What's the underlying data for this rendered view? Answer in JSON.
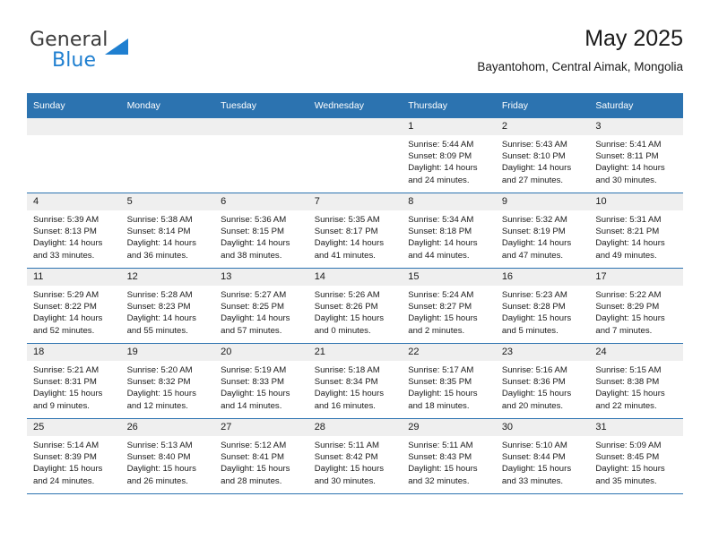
{
  "logo": {
    "text_top": "General",
    "text_bottom": "Blue",
    "triangle_icon": "triangle-icon",
    "color_blue": "#1f7fd0",
    "color_dark": "#3b3b3b"
  },
  "header": {
    "title": "May 2025",
    "subtitle": "Bayantohom, Central Aimak, Mongolia"
  },
  "theme": {
    "header_blue": "#2c73b0",
    "daynum_gray": "#efefef"
  },
  "calendar": {
    "weekday_headers": [
      "Sunday",
      "Monday",
      "Tuesday",
      "Wednesday",
      "Thursday",
      "Friday",
      "Saturday"
    ],
    "weeks": [
      [
        {
          "day": "",
          "empty": true
        },
        {
          "day": "",
          "empty": true
        },
        {
          "day": "",
          "empty": true
        },
        {
          "day": "",
          "empty": true
        },
        {
          "day": "1",
          "sunrise": "Sunrise: 5:44 AM",
          "sunset": "Sunset: 8:09 PM",
          "daylight1": "Daylight: 14 hours",
          "daylight2": "and 24 minutes."
        },
        {
          "day": "2",
          "sunrise": "Sunrise: 5:43 AM",
          "sunset": "Sunset: 8:10 PM",
          "daylight1": "Daylight: 14 hours",
          "daylight2": "and 27 minutes."
        },
        {
          "day": "3",
          "sunrise": "Sunrise: 5:41 AM",
          "sunset": "Sunset: 8:11 PM",
          "daylight1": "Daylight: 14 hours",
          "daylight2": "and 30 minutes."
        }
      ],
      [
        {
          "day": "4",
          "sunrise": "Sunrise: 5:39 AM",
          "sunset": "Sunset: 8:13 PM",
          "daylight1": "Daylight: 14 hours",
          "daylight2": "and 33 minutes."
        },
        {
          "day": "5",
          "sunrise": "Sunrise: 5:38 AM",
          "sunset": "Sunset: 8:14 PM",
          "daylight1": "Daylight: 14 hours",
          "daylight2": "and 36 minutes."
        },
        {
          "day": "6",
          "sunrise": "Sunrise: 5:36 AM",
          "sunset": "Sunset: 8:15 PM",
          "daylight1": "Daylight: 14 hours",
          "daylight2": "and 38 minutes."
        },
        {
          "day": "7",
          "sunrise": "Sunrise: 5:35 AM",
          "sunset": "Sunset: 8:17 PM",
          "daylight1": "Daylight: 14 hours",
          "daylight2": "and 41 minutes."
        },
        {
          "day": "8",
          "sunrise": "Sunrise: 5:34 AM",
          "sunset": "Sunset: 8:18 PM",
          "daylight1": "Daylight: 14 hours",
          "daylight2": "and 44 minutes."
        },
        {
          "day": "9",
          "sunrise": "Sunrise: 5:32 AM",
          "sunset": "Sunset: 8:19 PM",
          "daylight1": "Daylight: 14 hours",
          "daylight2": "and 47 minutes."
        },
        {
          "day": "10",
          "sunrise": "Sunrise: 5:31 AM",
          "sunset": "Sunset: 8:21 PM",
          "daylight1": "Daylight: 14 hours",
          "daylight2": "and 49 minutes."
        }
      ],
      [
        {
          "day": "11",
          "sunrise": "Sunrise: 5:29 AM",
          "sunset": "Sunset: 8:22 PM",
          "daylight1": "Daylight: 14 hours",
          "daylight2": "and 52 minutes."
        },
        {
          "day": "12",
          "sunrise": "Sunrise: 5:28 AM",
          "sunset": "Sunset: 8:23 PM",
          "daylight1": "Daylight: 14 hours",
          "daylight2": "and 55 minutes."
        },
        {
          "day": "13",
          "sunrise": "Sunrise: 5:27 AM",
          "sunset": "Sunset: 8:25 PM",
          "daylight1": "Daylight: 14 hours",
          "daylight2": "and 57 minutes."
        },
        {
          "day": "14",
          "sunrise": "Sunrise: 5:26 AM",
          "sunset": "Sunset: 8:26 PM",
          "daylight1": "Daylight: 15 hours",
          "daylight2": "and 0 minutes."
        },
        {
          "day": "15",
          "sunrise": "Sunrise: 5:24 AM",
          "sunset": "Sunset: 8:27 PM",
          "daylight1": "Daylight: 15 hours",
          "daylight2": "and 2 minutes."
        },
        {
          "day": "16",
          "sunrise": "Sunrise: 5:23 AM",
          "sunset": "Sunset: 8:28 PM",
          "daylight1": "Daylight: 15 hours",
          "daylight2": "and 5 minutes."
        },
        {
          "day": "17",
          "sunrise": "Sunrise: 5:22 AM",
          "sunset": "Sunset: 8:29 PM",
          "daylight1": "Daylight: 15 hours",
          "daylight2": "and 7 minutes."
        }
      ],
      [
        {
          "day": "18",
          "sunrise": "Sunrise: 5:21 AM",
          "sunset": "Sunset: 8:31 PM",
          "daylight1": "Daylight: 15 hours",
          "daylight2": "and 9 minutes."
        },
        {
          "day": "19",
          "sunrise": "Sunrise: 5:20 AM",
          "sunset": "Sunset: 8:32 PM",
          "daylight1": "Daylight: 15 hours",
          "daylight2": "and 12 minutes."
        },
        {
          "day": "20",
          "sunrise": "Sunrise: 5:19 AM",
          "sunset": "Sunset: 8:33 PM",
          "daylight1": "Daylight: 15 hours",
          "daylight2": "and 14 minutes."
        },
        {
          "day": "21",
          "sunrise": "Sunrise: 5:18 AM",
          "sunset": "Sunset: 8:34 PM",
          "daylight1": "Daylight: 15 hours",
          "daylight2": "and 16 minutes."
        },
        {
          "day": "22",
          "sunrise": "Sunrise: 5:17 AM",
          "sunset": "Sunset: 8:35 PM",
          "daylight1": "Daylight: 15 hours",
          "daylight2": "and 18 minutes."
        },
        {
          "day": "23",
          "sunrise": "Sunrise: 5:16 AM",
          "sunset": "Sunset: 8:36 PM",
          "daylight1": "Daylight: 15 hours",
          "daylight2": "and 20 minutes."
        },
        {
          "day": "24",
          "sunrise": "Sunrise: 5:15 AM",
          "sunset": "Sunset: 8:38 PM",
          "daylight1": "Daylight: 15 hours",
          "daylight2": "and 22 minutes."
        }
      ],
      [
        {
          "day": "25",
          "sunrise": "Sunrise: 5:14 AM",
          "sunset": "Sunset: 8:39 PM",
          "daylight1": "Daylight: 15 hours",
          "daylight2": "and 24 minutes."
        },
        {
          "day": "26",
          "sunrise": "Sunrise: 5:13 AM",
          "sunset": "Sunset: 8:40 PM",
          "daylight1": "Daylight: 15 hours",
          "daylight2": "and 26 minutes."
        },
        {
          "day": "27",
          "sunrise": "Sunrise: 5:12 AM",
          "sunset": "Sunset: 8:41 PM",
          "daylight1": "Daylight: 15 hours",
          "daylight2": "and 28 minutes."
        },
        {
          "day": "28",
          "sunrise": "Sunrise: 5:11 AM",
          "sunset": "Sunset: 8:42 PM",
          "daylight1": "Daylight: 15 hours",
          "daylight2": "and 30 minutes."
        },
        {
          "day": "29",
          "sunrise": "Sunrise: 5:11 AM",
          "sunset": "Sunset: 8:43 PM",
          "daylight1": "Daylight: 15 hours",
          "daylight2": "and 32 minutes."
        },
        {
          "day": "30",
          "sunrise": "Sunrise: 5:10 AM",
          "sunset": "Sunset: 8:44 PM",
          "daylight1": "Daylight: 15 hours",
          "daylight2": "and 33 minutes."
        },
        {
          "day": "31",
          "sunrise": "Sunrise: 5:09 AM",
          "sunset": "Sunset: 8:45 PM",
          "daylight1": "Daylight: 15 hours",
          "daylight2": "and 35 minutes."
        }
      ]
    ]
  }
}
